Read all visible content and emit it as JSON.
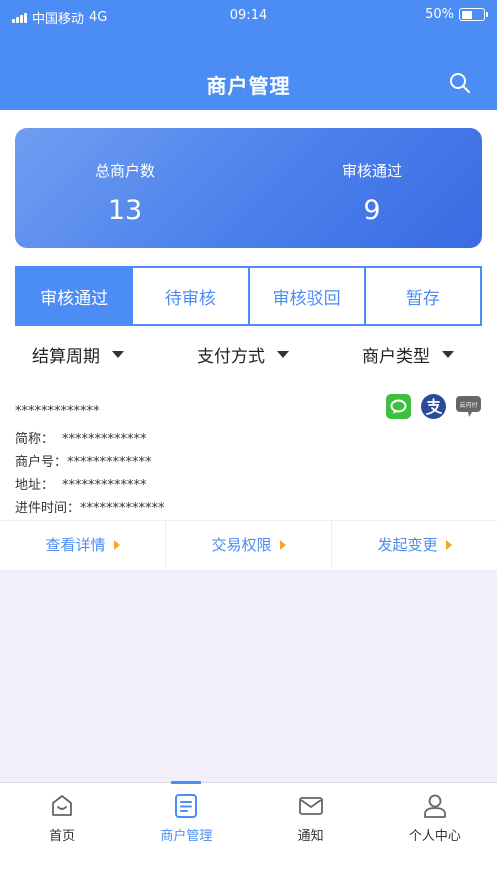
{
  "status_bar": {
    "carrier": "中国移动",
    "network": "4G",
    "time": "09:14",
    "battery": "50%",
    "battery_level": 0.5
  },
  "header": {
    "title": "商户管理",
    "search_icon": "search-icon"
  },
  "stats": [
    {
      "label": "总商户数",
      "value": "13"
    },
    {
      "label": "审核通过",
      "value": "9"
    }
  ],
  "tabs": [
    {
      "label": "审核通过",
      "active": true
    },
    {
      "label": "待审核",
      "active": false
    },
    {
      "label": "审核驳回",
      "active": false
    },
    {
      "label": "暂存",
      "active": false
    }
  ],
  "filters": [
    {
      "label": "结算周期"
    },
    {
      "label": "支付方式"
    },
    {
      "label": "商户类型"
    }
  ],
  "merchant": {
    "name": "*************",
    "short_name_label": "简称：",
    "short_name": "*************",
    "merchant_no_label": "商户号：",
    "merchant_no": "*************",
    "address_label": "地址：",
    "address": "*************",
    "entry_time_label": "进件时间：",
    "entry_time": "*************",
    "payment_icons": [
      "wechat-pay-icon",
      "alipay-icon",
      "unionpay-icon"
    ],
    "unionpay_text": "云闪付"
  },
  "actions": [
    {
      "label": "查看详情"
    },
    {
      "label": "交易权限"
    },
    {
      "label": "发起变更"
    }
  ],
  "bottom_nav": [
    {
      "label": "首页",
      "icon": "home-icon",
      "active": false
    },
    {
      "label": "商户管理",
      "icon": "document-icon",
      "active": true
    },
    {
      "label": "通知",
      "icon": "mail-icon",
      "active": false
    },
    {
      "label": "个人中心",
      "icon": "user-icon",
      "active": false
    }
  ],
  "colors": {
    "primary": "#4b8cf5",
    "accent_arrow": "#f5a623",
    "background": "#f1f0fa"
  }
}
